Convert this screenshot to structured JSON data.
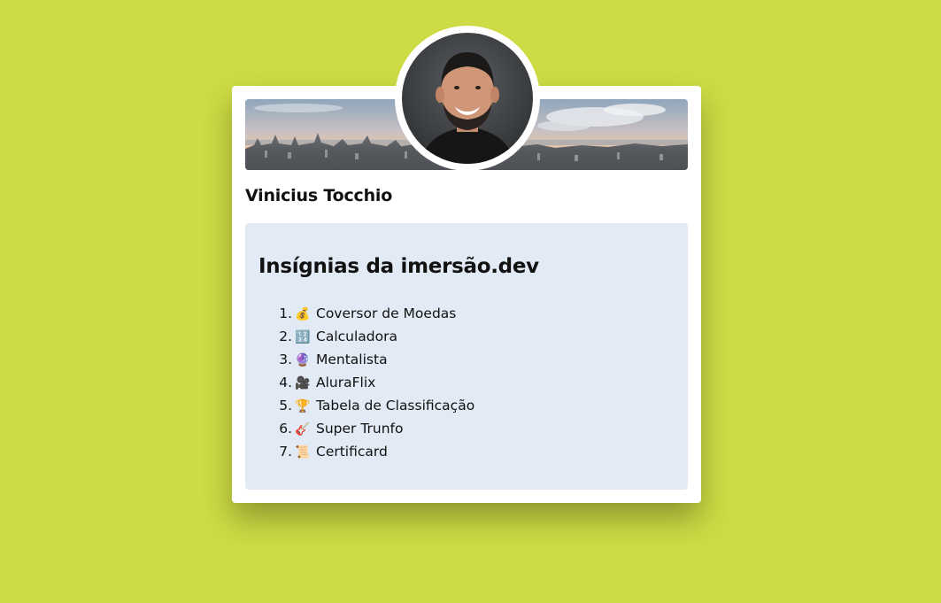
{
  "profile": {
    "name": "Vinicius Tocchio"
  },
  "colors": {
    "page_background": "#cddc44",
    "card_background": "#ffffff",
    "badges_background": "#e2ebf5"
  },
  "badges": {
    "title": "Insígnias da imersão.dev",
    "items": [
      {
        "number": "1.",
        "emoji": "💰",
        "icon": "money-bag-icon",
        "label": "Coversor de Moedas"
      },
      {
        "number": "2.",
        "emoji": "🔢",
        "icon": "numbers-icon",
        "label": "Calculadora"
      },
      {
        "number": "3.",
        "emoji": "🔮",
        "icon": "crystal-ball-icon",
        "label": "Mentalista"
      },
      {
        "number": "4.",
        "emoji": "🎥",
        "icon": "movie-camera-icon",
        "label": "AluraFlix"
      },
      {
        "number": "5.",
        "emoji": "🏆",
        "icon": "trophy-icon",
        "label": "Tabela de Classificação"
      },
      {
        "number": "6.",
        "emoji": "🎸",
        "icon": "guitar-icon",
        "label": "Super Trunfo"
      },
      {
        "number": "7.",
        "emoji": "📜",
        "icon": "scroll-icon",
        "label": "Certificard"
      }
    ]
  }
}
